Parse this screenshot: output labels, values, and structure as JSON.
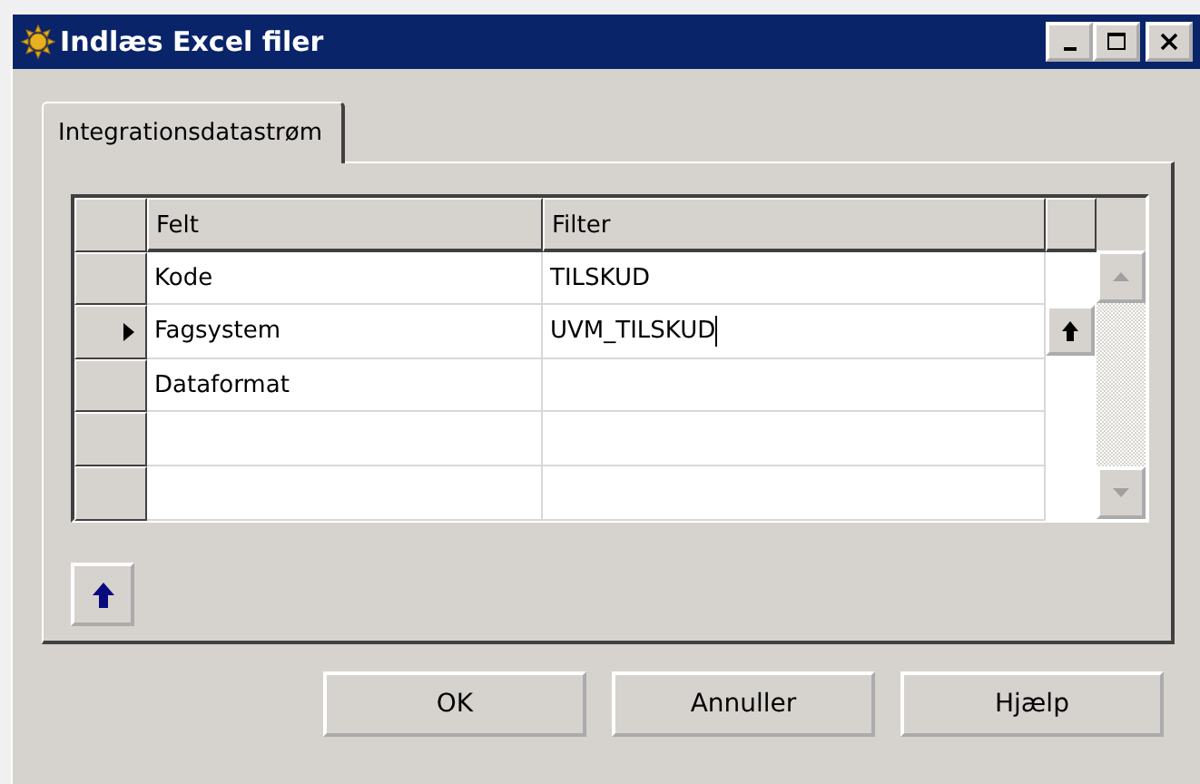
{
  "window": {
    "title": "Indlæs Excel filer"
  },
  "tabs": [
    {
      "label": "Integrationsdatastrøm",
      "selected": true
    }
  ],
  "table": {
    "columns": [
      "Felt",
      "Filter"
    ],
    "rows": [
      {
        "felt": "Kode",
        "filter": "TILSKUD",
        "selected": false
      },
      {
        "felt": "Fagsystem",
        "filter": "UVM_TILSKUD",
        "selected": true
      },
      {
        "felt": "Dataformat",
        "selected": false
      },
      {
        "selected": false
      },
      {
        "selected": false
      }
    ]
  },
  "buttons": [
    "OK",
    "Annuller",
    "Hjælp"
  ]
}
